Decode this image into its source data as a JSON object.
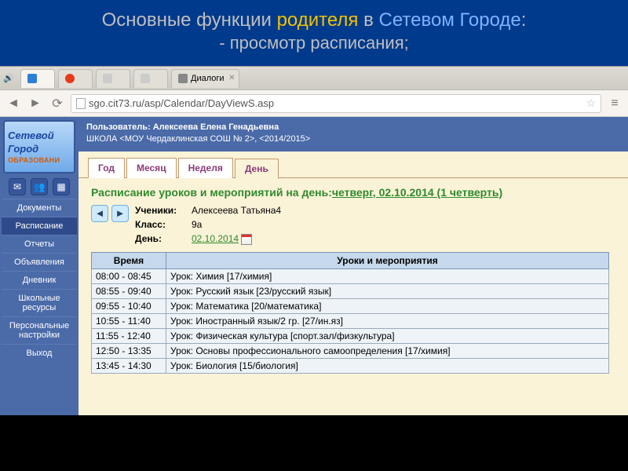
{
  "slide": {
    "title_p1": "Основные функции ",
    "title_p2": "родителя",
    "title_p3": " в ",
    "title_p4": "Сетевом Городе",
    "title_p5": ":",
    "subtitle": "- просмотр расписания;"
  },
  "browser": {
    "tabs": [
      {
        "label": ""
      },
      {
        "label": ""
      },
      {
        "label": ""
      },
      {
        "label": ""
      },
      {
        "label": "Диалоги"
      }
    ],
    "url": "sgo.cit73.ru/asp/Calendar/DayViewS.asp"
  },
  "sidebar": {
    "logo_line1": "Сетевой",
    "logo_line2": "Город",
    "logo_line3": "ОБРАЗОВАНИ",
    "items": [
      {
        "label": "Документы"
      },
      {
        "label": "Расписание"
      },
      {
        "label": "Отчеты"
      },
      {
        "label": "Объявления"
      },
      {
        "label": "Дневник"
      },
      {
        "label": "Школьные ресурсы"
      },
      {
        "label": "Персональные настройки"
      },
      {
        "label": "Выход"
      }
    ]
  },
  "user": {
    "line1": "Пользователь: Алексеева Елена Генадьевна",
    "line2": "ШКОЛА <МОУ Чердаклинская СОШ № 2>,  <2014/2015>"
  },
  "view_tabs": [
    "Год",
    "Месяц",
    "Неделя",
    "День"
  ],
  "page_title_prefix": "Расписание уроков и мероприятий на день:",
  "page_title_date": "четверг, 02.10.2014 (1 четверть)",
  "filters": {
    "student_label": "Ученики:",
    "student_value": "Алексеева Татьяна4",
    "class_label": "Класс:",
    "class_value": "9а",
    "day_label": "День:",
    "day_value": "02.10.2014"
  },
  "table": {
    "col_time": "Время",
    "col_event": "Уроки и мероприятия",
    "rows": [
      {
        "time": "08:00 - 08:45",
        "event": "Урок: Химия [17/химия]"
      },
      {
        "time": "08:55 - 09:40",
        "event": "Урок: Русский язык [23/русский язык]"
      },
      {
        "time": "09:55 - 10:40",
        "event": "Урок: Математика [20/математика]"
      },
      {
        "time": "10:55 - 11:40",
        "event": "Урок: Иностранный язык/2 гр. [27/ин.яз]"
      },
      {
        "time": "11:55 - 12:40",
        "event": "Урок: Физическая культура [спорт.зал/физкультура]"
      },
      {
        "time": "12:50 - 13:35",
        "event": "Урок: Основы профессионального самоопределения [17/химия]"
      },
      {
        "time": "13:45 - 14:30",
        "event": "Урок: Биология [15/биология]"
      }
    ]
  }
}
